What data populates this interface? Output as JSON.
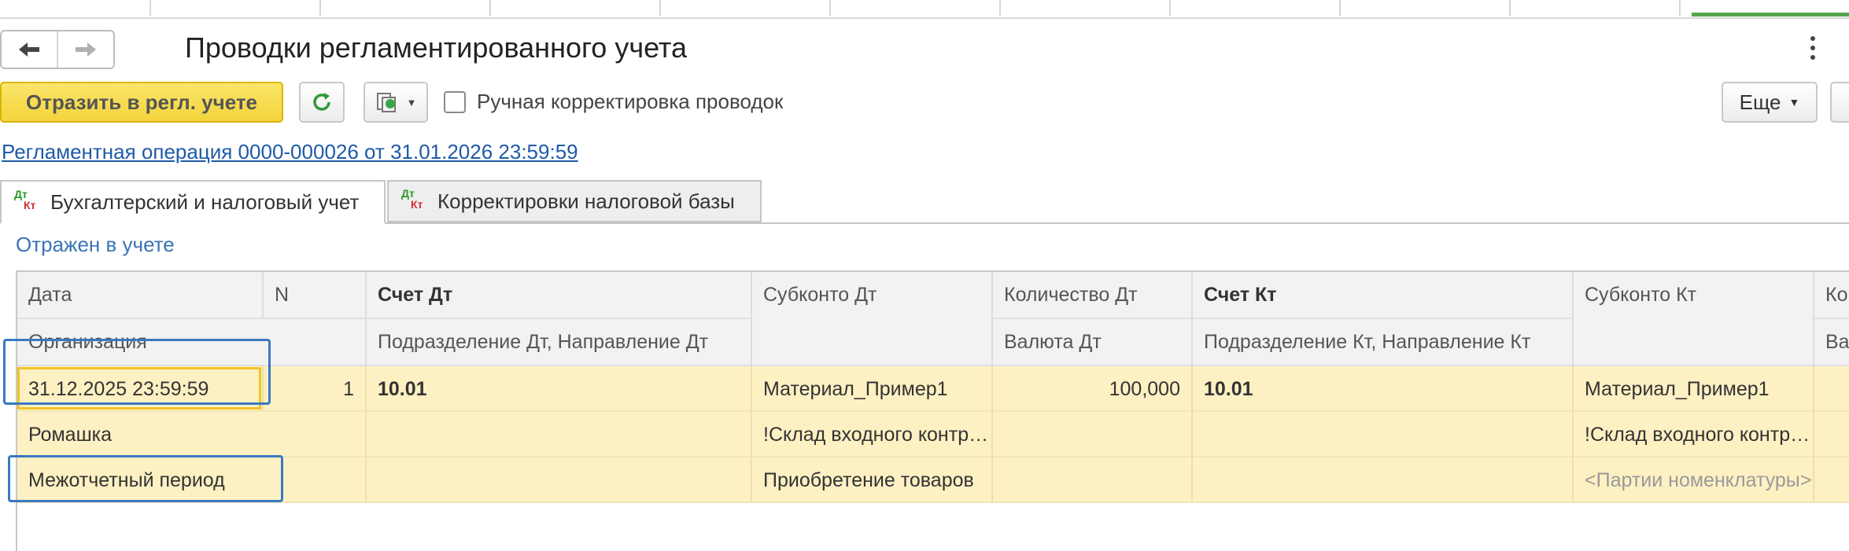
{
  "window": {
    "title": "Проводки регламентированного учета"
  },
  "nav": {
    "back_label": "Назад",
    "forward_label": "Вперед"
  },
  "toolbar": {
    "primary_label": "Отразить в регл. учете",
    "manual_correction_label": "Ручная корректировка проводок",
    "manual_correction_checked": false,
    "more_label": "Еще"
  },
  "operation_link": "Регламентная операция 0000-000026 от 31.01.2026 23:59:59",
  "tabs": [
    {
      "label": "Бухгалтерский и налоговый учет",
      "active": true,
      "icon_dt": "Дт",
      "icon_kt": "Кт"
    },
    {
      "label": "Корректировки налоговой базы",
      "active": false,
      "icon_dt": "Дт",
      "icon_kt": "Кт"
    }
  ],
  "status": "Отражен в учете",
  "grid": {
    "headers": {
      "date": "Дата",
      "n": "N",
      "account_dt": "Счет Дт",
      "subconto_dt": "Субконто Дт",
      "qty_dt": "Количество Дт",
      "account_kt": "Счет Кт",
      "subconto_kt": "Субконто Кт",
      "more_col": "Ко",
      "organization": "Организация",
      "dept_dt": "Подразделение Дт, Направление Дт",
      "currency_dt": "Валюта Дт",
      "dept_kt": "Подразделение Кт, Направление Кт",
      "more_col2": "Ва"
    },
    "row": {
      "date": "31.12.2025 23:59:59",
      "n": "1",
      "account_dt": "10.01",
      "subconto_dt_1": "Материал_Пример1",
      "qty_dt": "100,000",
      "account_kt": "10.01",
      "subconto_kt_1": "Материал_Пример1",
      "organization": "Ромашка",
      "subconto_dt_2": "!Склад входного контроля",
      "subconto_kt_2": "!Склад входного контроля",
      "period": "Межотчетный период",
      "subconto_dt_3": "Приобретение товаров",
      "subconto_kt_3": "<Партии номенклатуры>"
    }
  },
  "colors": {
    "accent_yellow": "#f3d43c",
    "row_highlight": "#fdf0c3",
    "link_blue": "#1f5aa8",
    "annotation_blue": "#3a78c1"
  }
}
